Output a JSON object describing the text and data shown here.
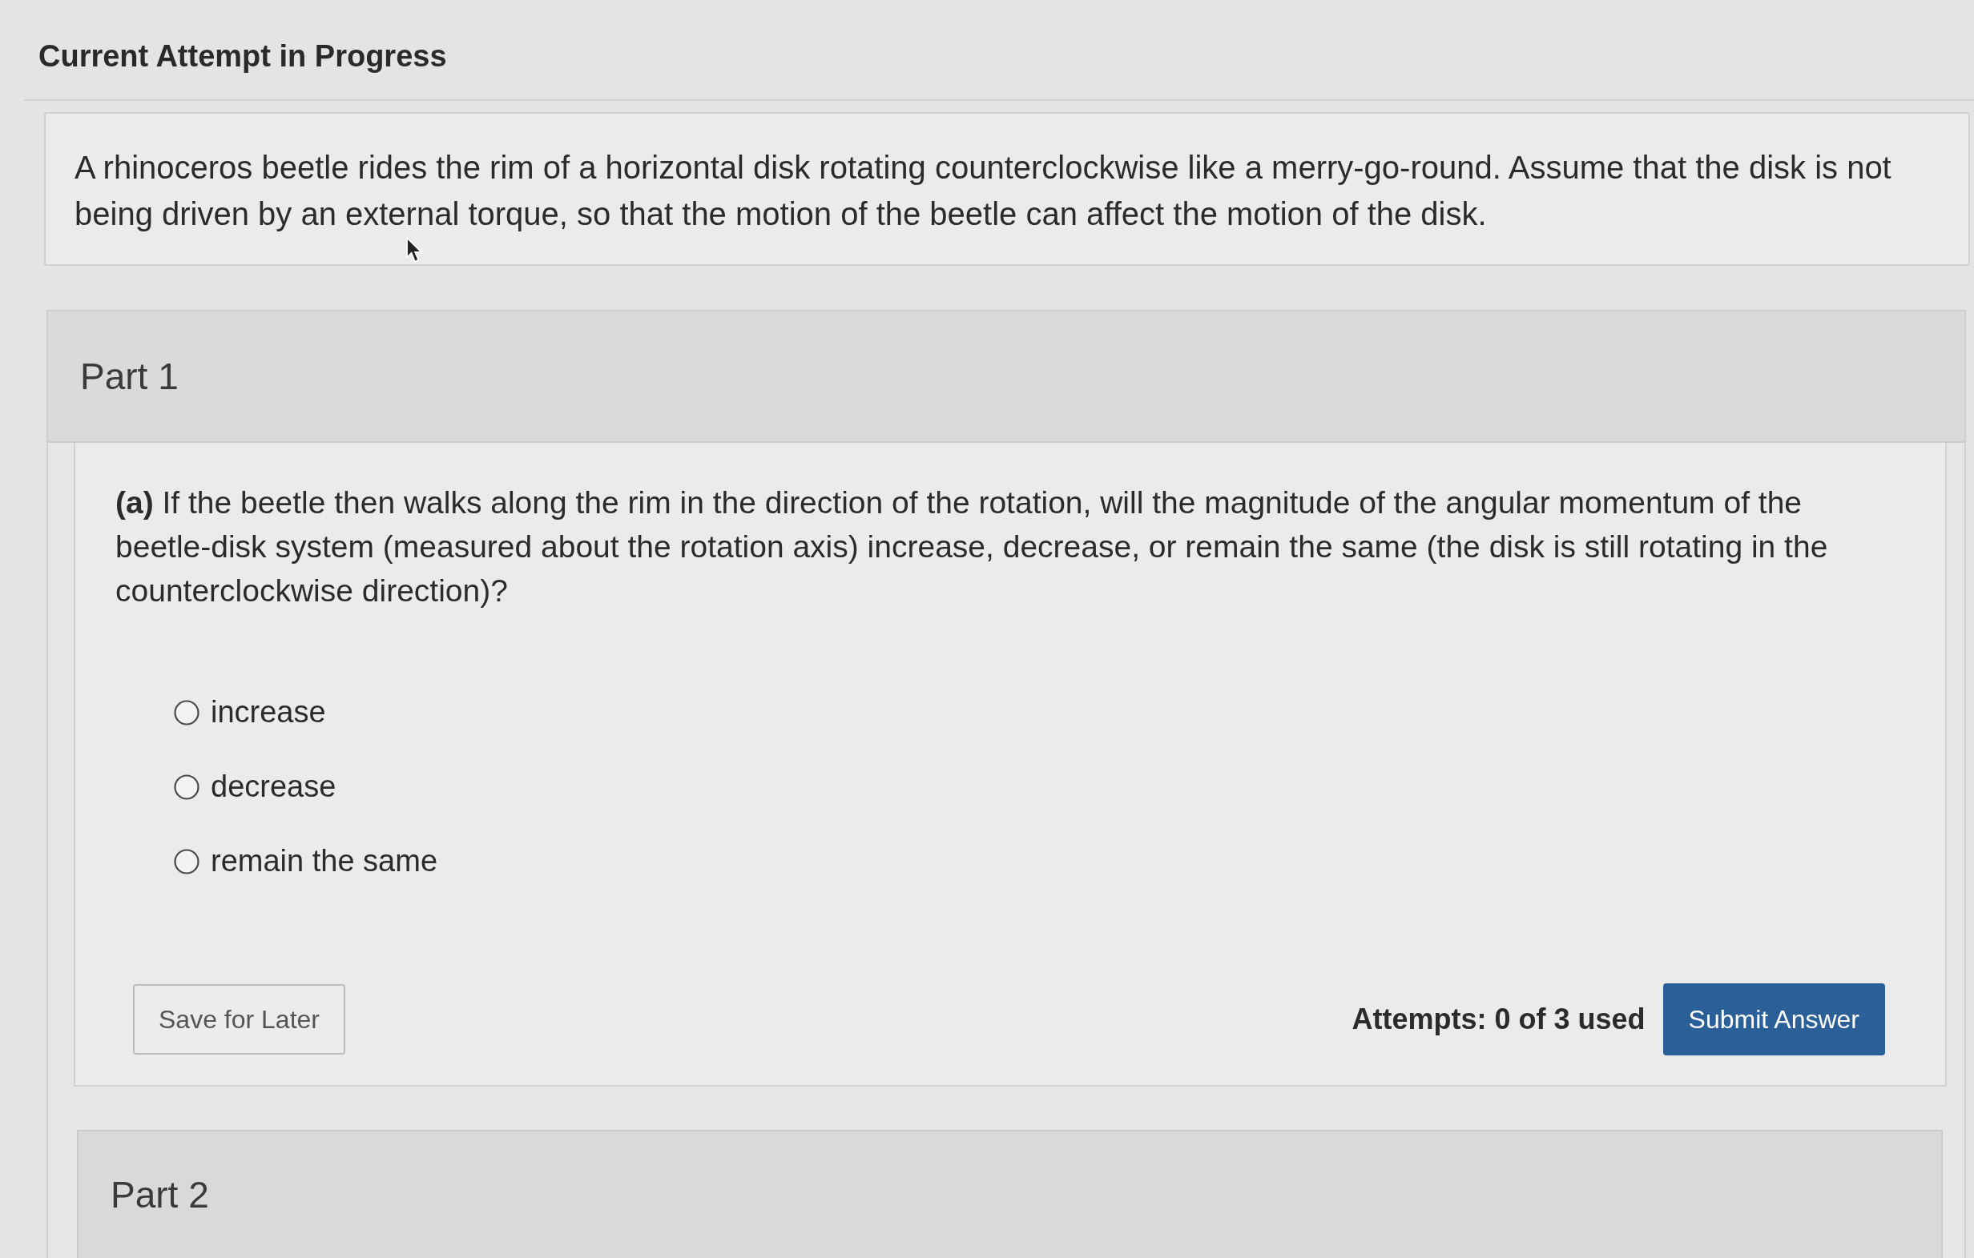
{
  "page": {
    "title": "Current Attempt in Progress"
  },
  "intro": {
    "text": "A rhinoceros beetle rides the rim of a horizontal disk rotating counterclockwise like a merry-go-round. Assume that the disk is not being driven by an external torque, so that the motion of the beetle can affect the motion of the disk."
  },
  "parts": [
    {
      "title": "Part 1",
      "question": "**(a)** If the beetle then walks along the rim in the direction of the rotation, will the magnitude of the angular momentum of the beetle-disk system (measured about the rotation axis) increase, decrease, or remain the same (the disk is still rotating in the counterclockwise direction)?",
      "options": [
        {
          "label": "increase",
          "selected": false
        },
        {
          "label": "decrease",
          "selected": false
        },
        {
          "label": "remain the same",
          "selected": false
        }
      ],
      "save_button": "Save for Later",
      "attempts": "Attempts: 0 of 3 used",
      "submit_button": "Submit Answer"
    },
    {
      "title": "Part 2"
    }
  ]
}
